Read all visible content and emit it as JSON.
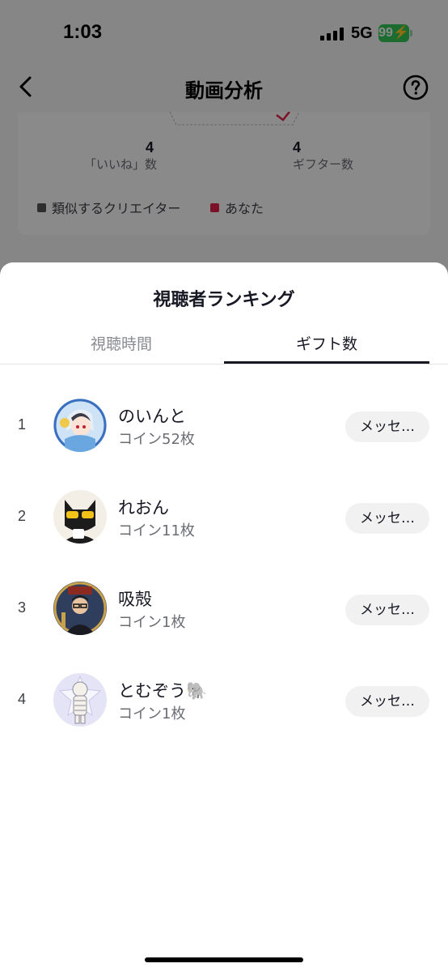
{
  "status_bar": {
    "time": "1:03",
    "network": "5G",
    "battery": "99"
  },
  "nav": {
    "title": "動画分析",
    "back_icon": "chevron-left-icon",
    "help_icon": "question-circle-icon"
  },
  "stats": {
    "likes_value": "4",
    "likes_label": "「いいね」数",
    "gifters_value": "4",
    "gifters_label": "ギフター数",
    "legend": [
      {
        "label": "類似するクリエイター",
        "color": "#555555"
      },
      {
        "label": "あなた",
        "color": "#e6224a"
      }
    ]
  },
  "sheet": {
    "title": "視聴者ランキング",
    "tabs": [
      {
        "label": "視聴時間",
        "active": false
      },
      {
        "label": "ギフト数",
        "active": true
      }
    ],
    "viewers": [
      {
        "rank": "1",
        "name": "のいんと",
        "coins": "コイン52枚",
        "button": "メッセ…"
      },
      {
        "rank": "2",
        "name": "れおん",
        "coins": "コイン11枚",
        "button": "メッセ…"
      },
      {
        "rank": "3",
        "name": "吸殻",
        "coins": "コイン1枚",
        "button": "メッセ…"
      },
      {
        "rank": "4",
        "name": "とむぞう🐘",
        "coins": "コイン1枚",
        "button": "メッセ…"
      }
    ]
  },
  "colors": {
    "accent": "#e6224a",
    "battery": "#34c759"
  }
}
